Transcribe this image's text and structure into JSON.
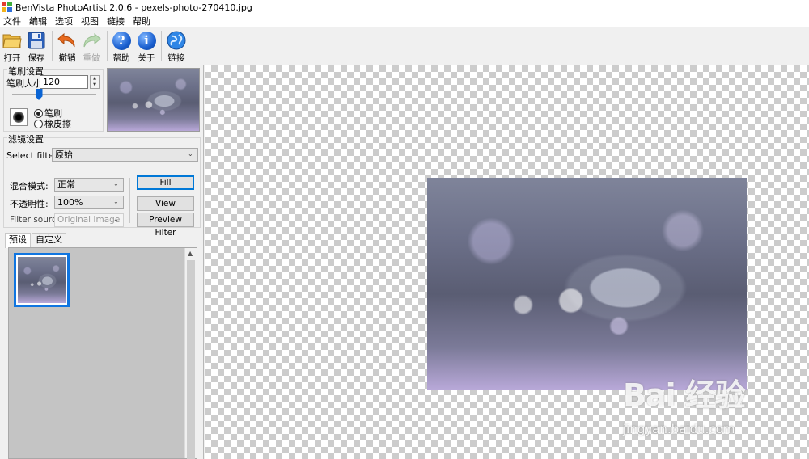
{
  "window": {
    "title": "BenVista PhotoArtist 2.0.6 - pexels-photo-270410.jpg"
  },
  "menu": [
    "文件",
    "编辑",
    "选项",
    "视图",
    "链接",
    "帮助"
  ],
  "toolbar": {
    "open": "打开",
    "save": "保存",
    "undo": "撤销",
    "redo": "重做",
    "help": "帮助",
    "about": "关于",
    "link": "链接"
  },
  "brush": {
    "group_title": "笔刷设置",
    "size_label": "笔刷大小:",
    "size_value": "120",
    "size_level": 0.3,
    "mode_brush": "笔刷",
    "mode_eraser": "橡皮擦",
    "selected_mode": "brush"
  },
  "filter": {
    "group_title": "滤镜设置",
    "select_label": "Select filter:",
    "selected_filter": "原始",
    "blend_label": "混合模式:",
    "blend_value": "正常",
    "opacity_label": "不透明性:",
    "opacity_value": "100%",
    "source_label": "Filter source:",
    "source_value": "Original Image",
    "fill_button": "Fill",
    "view_original_button": "View Original",
    "preview_filter_button": "Preview Filter"
  },
  "tabs": [
    "预设",
    "自定义"
  ],
  "active_tab": 0,
  "watermark": {
    "logo": "Bai 经验",
    "url": "jingyan.baidu.com"
  },
  "colors": {
    "accent": "#0078d7",
    "selection": "#1075e0",
    "toolbar_blue": "#1a5fcf"
  }
}
